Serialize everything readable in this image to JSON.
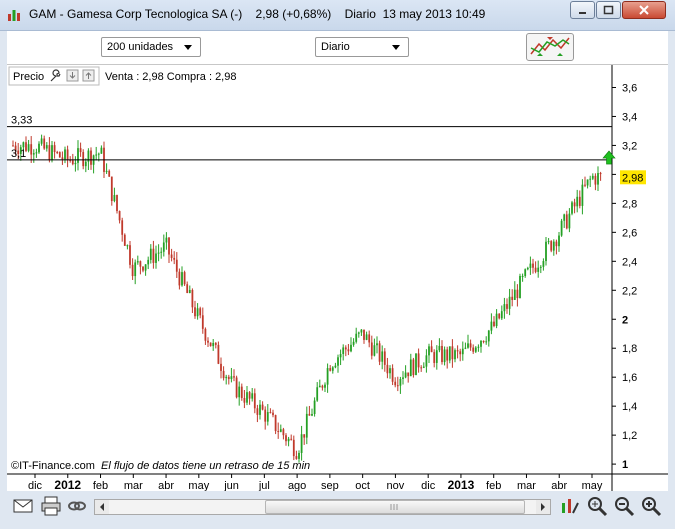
{
  "window": {
    "title": "GAM - Gamesa Corp Tecnologica SA (-)    2,98 (+0,68%)    Diario  13 may 2013 10:49"
  },
  "toolbar": {
    "units_select": "200 unidades",
    "period_select": "Diario"
  },
  "legend": {
    "price_label": "Precio",
    "bid_ask": "Venta : 2,98 Compra : 2,98"
  },
  "chart": {
    "lines": [
      {
        "label": "3,33",
        "value": 3.33
      },
      {
        "label": "3,1",
        "value": 3.1
      }
    ],
    "last_price_label": "2,98",
    "credit": "©IT-Finance.com",
    "delay_note": "El flujo de datos tiene un retraso de 15 min"
  },
  "colors": {
    "up": "#24a024",
    "down": "#c0392b",
    "last_badge": "#ffe600",
    "arrow": "#1fbf1f"
  },
  "chart_data": {
    "type": "candlestick",
    "y_ticks": [
      "3,6",
      "3,4",
      "3,2",
      "3",
      "2,8",
      "2,6",
      "2,4",
      "2,2",
      "2",
      "1,8",
      "1,6",
      "1,4",
      "1,2",
      "1"
    ],
    "x_ticks": [
      "dic",
      "2012",
      "feb",
      "mar",
      "abr",
      "may",
      "jun",
      "jul",
      "ago",
      "sep",
      "oct",
      "nov",
      "dic",
      "2013",
      "feb",
      "mar",
      "abr",
      "may"
    ],
    "ylim": [
      0.98,
      3.7
    ],
    "last": 2.98,
    "close_path": [
      {
        "x": "dic",
        "y": 3.2
      },
      {
        "x": "2012",
        "y": 3.1
      },
      {
        "x": "feb",
        "y": 3.15
      },
      {
        "x": "mar",
        "y": 2.35
      },
      {
        "x": "abr",
        "y": 2.5
      },
      {
        "x": "may",
        "y": 2.0
      },
      {
        "x": "jun",
        "y": 1.55
      },
      {
        "x": "jul",
        "y": 1.35
      },
      {
        "x": "ago",
        "y": 1.1
      },
      {
        "x": "sep",
        "y": 1.7
      },
      {
        "x": "oct",
        "y": 1.9
      },
      {
        "x": "nov",
        "y": 1.6
      },
      {
        "x": "dic",
        "y": 1.75
      },
      {
        "x": "2013",
        "y": 1.75
      },
      {
        "x": "feb",
        "y": 1.95
      },
      {
        "x": "mar",
        "y": 2.3
      },
      {
        "x": "abr",
        "y": 2.6
      },
      {
        "x": "may",
        "y": 2.98
      }
    ]
  }
}
